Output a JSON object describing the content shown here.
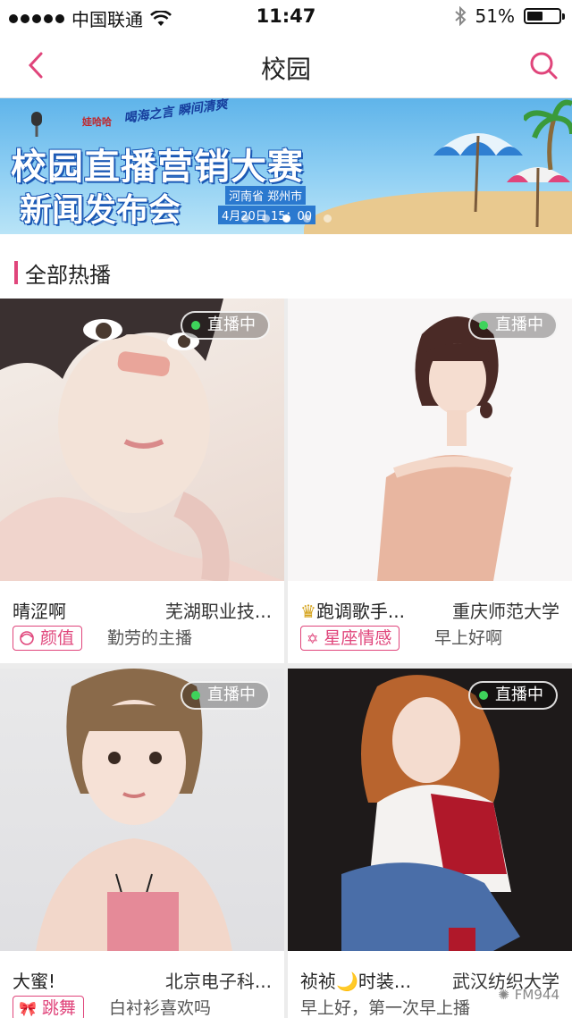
{
  "status_bar": {
    "carrier": "中国联通",
    "time": "11:47",
    "battery": "51%",
    "battery_level": 0.51
  },
  "nav": {
    "title": "校园",
    "back_icon": "chevron-left-icon",
    "search_icon": "search-icon"
  },
  "banner": {
    "brand": "娃哈哈",
    "tagline": "喝海之言 瞬间清爽",
    "line1": "校园直播营销大赛",
    "line2": "新闻发布会",
    "location": "河南省 郑州市",
    "datetime": "4月20日 15：00",
    "pages": 5,
    "active_page": 2
  },
  "section": {
    "title": "全部热播"
  },
  "colors": {
    "accent": "#e0457b",
    "live_dot": "#3ed35b"
  },
  "cards": [
    {
      "live": "直播中",
      "name": "晴涩啊",
      "school": "芜湖职业技...",
      "tag": "颜值",
      "tag_icon": "face-icon",
      "desc": "勤劳的主播"
    },
    {
      "live": "直播中",
      "name": "跑调歌手...",
      "name_icon": "crown-icon",
      "school": "重庆师范大学",
      "tag": "星座情感",
      "tag_icon": "star-of-david-icon",
      "desc": "早上好啊"
    },
    {
      "live": "直播中",
      "name": "大蜜!",
      "school": "北京电子科...",
      "tag": "跳舞",
      "tag_icon": "ribbon-icon",
      "desc": "白衬衫喜欢吗"
    },
    {
      "live": "直播中",
      "name": "祯祯🌙时装...",
      "school": "武汉纺织大学",
      "tag": "",
      "desc": "早上好，第一次早上播"
    }
  ],
  "watermark": "FM944"
}
